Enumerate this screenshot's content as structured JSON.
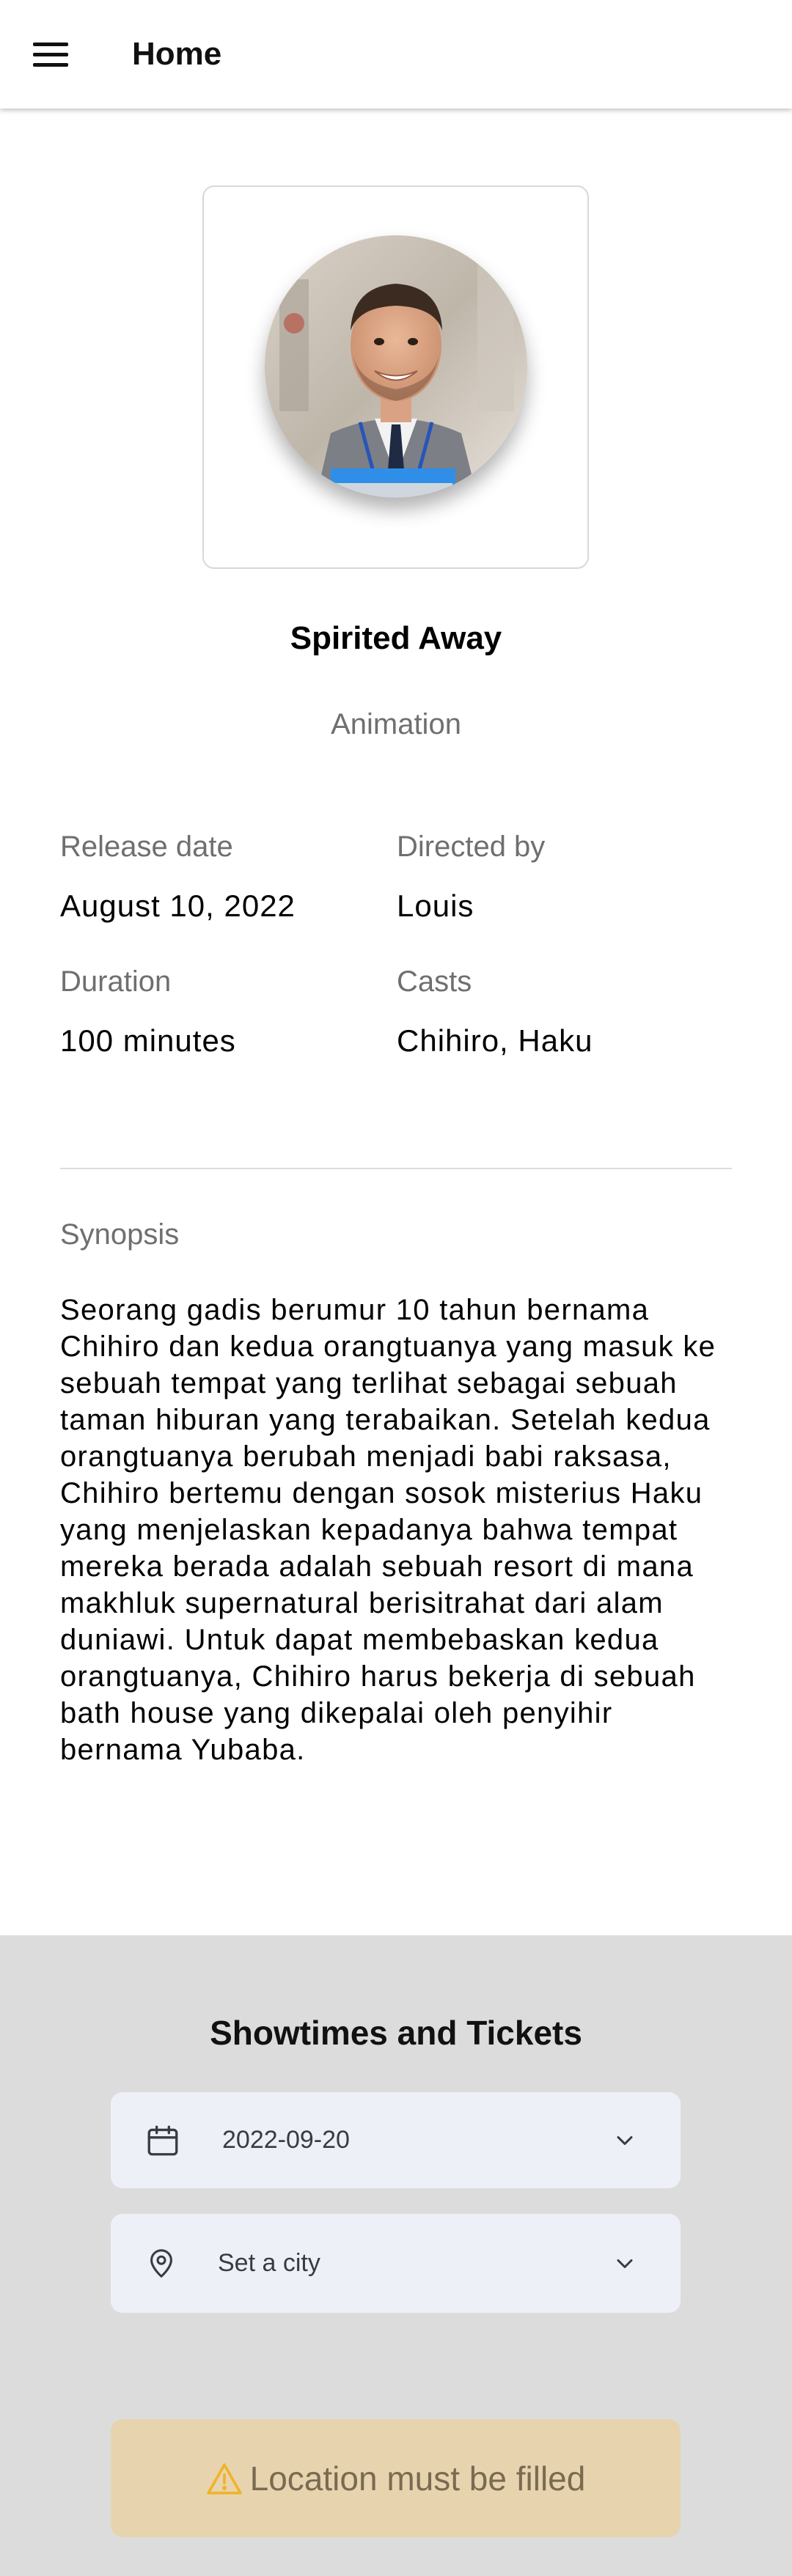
{
  "appbar": {
    "menu_icon": "hamburger-menu-icon",
    "title": "Home"
  },
  "movie": {
    "poster_icon": "person-photo",
    "title": "Spirited Away",
    "genre": "Animation"
  },
  "details": {
    "release_label": "Release date",
    "release_value": "August 10, 2022",
    "director_label": "Directed by",
    "director_value": "Louis",
    "duration_label": "Duration",
    "duration_value": "100 minutes",
    "casts_label": "Casts",
    "casts_value": "Chihiro, Haku"
  },
  "synopsis": {
    "label": "Synopsis",
    "text": "Seorang gadis berumur 10 tahun bernama Chihiro dan kedua orangtuanya yang masuk ke sebuah tempat yang terlihat sebagai sebuah taman hiburan yang terabaikan. Setelah kedua orangtuanya berubah menjadi babi raksasa, Chihiro bertemu dengan sosok misterius Haku yang menjelaskan kepadanya bahwa tempat mereka berada adalah sebuah resort di mana makhluk supernatural berisitrahat dari alam duniawi. Untuk dapat membebaskan kedua orangtuanya, Chihiro harus bekerja di sebuah bath house yang dikepalai oleh penyihir bernama Yubaba."
  },
  "showtimes": {
    "title": "Showtimes and Tickets",
    "date": {
      "icon": "calendar-icon",
      "value": "2022-09-20",
      "chevron_icon": "chevron-down-icon"
    },
    "city": {
      "icon": "location-pin-icon",
      "placeholder": "Set a city",
      "chevron_icon": "chevron-down-icon"
    },
    "alert": {
      "icon": "warning-icon",
      "message": "Location must be filled"
    }
  },
  "colors": {
    "alert_bg": "#e7d4af",
    "alert_icon": "#f0b429",
    "section_bg": "#dcdcdc",
    "select_bg": "#eef0f7"
  }
}
